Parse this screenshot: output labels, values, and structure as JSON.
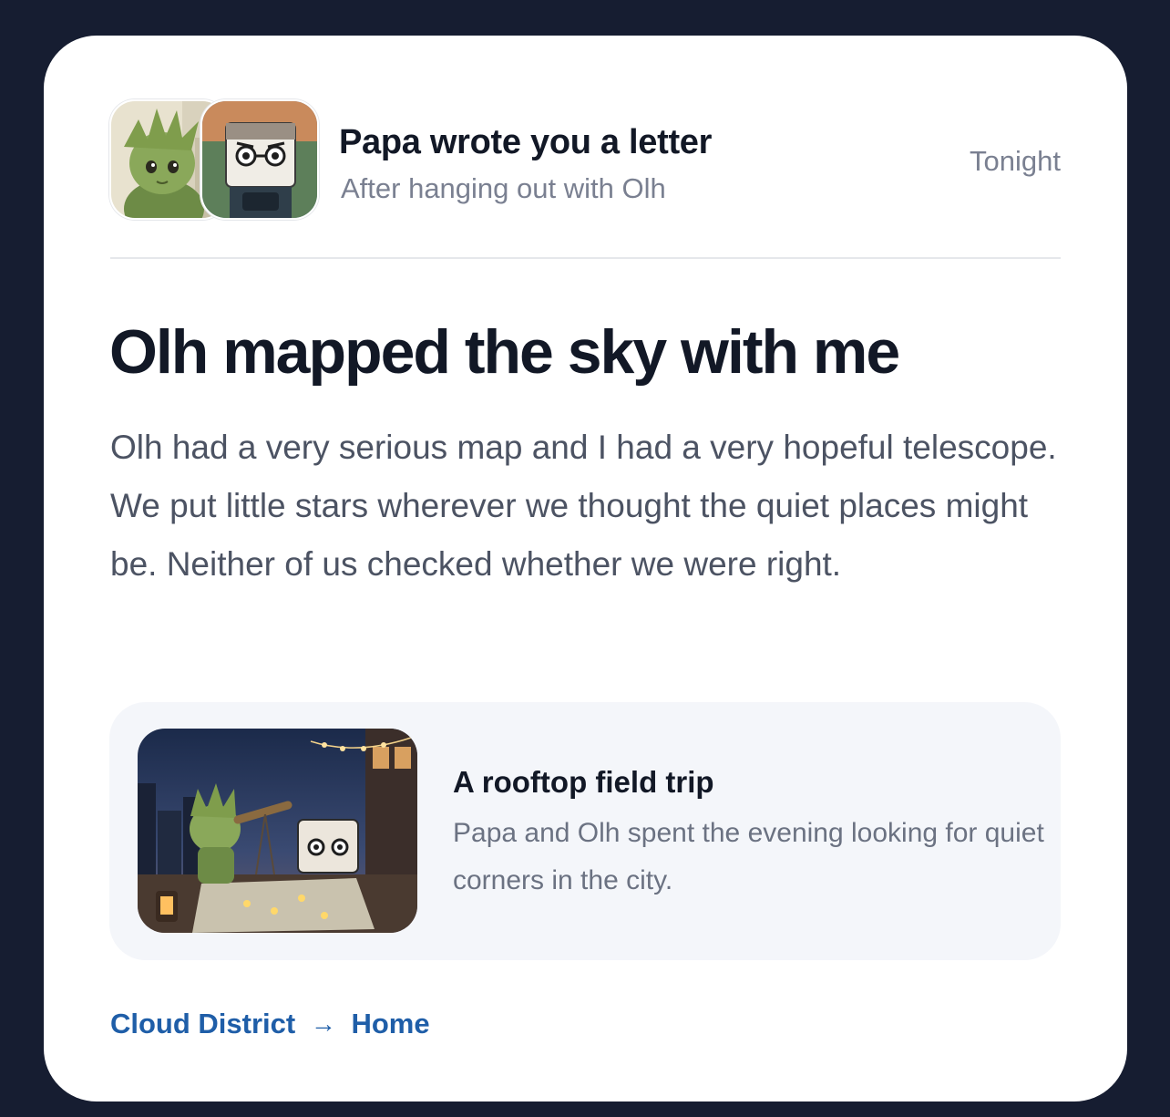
{
  "header": {
    "title": "Papa wrote you a letter",
    "subtitle": "After hanging out with Olh",
    "time": "Tonight",
    "avatars": [
      "olh-avatar-icon",
      "papa-avatar-icon"
    ]
  },
  "letter": {
    "headline": "Olh mapped the sky with me",
    "body": "Olh had a very serious map and I had a very hopeful telescope. We put little stars wherever we thought the quiet places might be. Neither of us checked whether we were right."
  },
  "trip": {
    "title": "A rooftop field trip",
    "description": "Papa and Olh spent the evening looking for quiet corners in the city.",
    "image": "rooftop-night-scene-icon"
  },
  "route": {
    "from": "Cloud District",
    "arrow": "→",
    "to": "Home"
  },
  "colors": {
    "background": "#161d31",
    "card": "#ffffff",
    "accent": "#1f5ea8",
    "title": "#121826",
    "muted": "#7a8091"
  }
}
